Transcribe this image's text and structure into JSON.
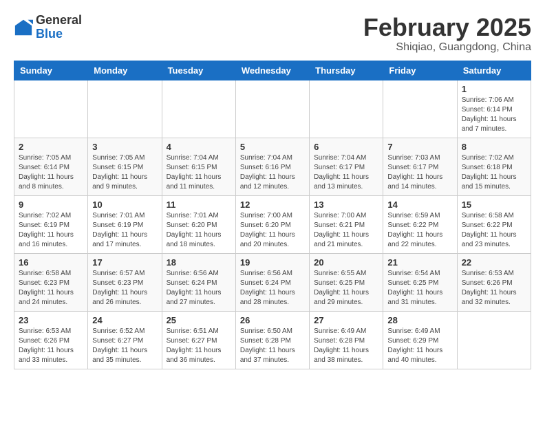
{
  "header": {
    "logo": {
      "general": "General",
      "blue": "Blue"
    },
    "title": "February 2025",
    "location": "Shiqiao, Guangdong, China"
  },
  "weekdays": [
    "Sunday",
    "Monday",
    "Tuesday",
    "Wednesday",
    "Thursday",
    "Friday",
    "Saturday"
  ],
  "weeks": [
    [
      {
        "day": "",
        "info": ""
      },
      {
        "day": "",
        "info": ""
      },
      {
        "day": "",
        "info": ""
      },
      {
        "day": "",
        "info": ""
      },
      {
        "day": "",
        "info": ""
      },
      {
        "day": "",
        "info": ""
      },
      {
        "day": "1",
        "info": "Sunrise: 7:06 AM\nSunset: 6:14 PM\nDaylight: 11 hours\nand 7 minutes."
      }
    ],
    [
      {
        "day": "2",
        "info": "Sunrise: 7:05 AM\nSunset: 6:14 PM\nDaylight: 11 hours\nand 8 minutes."
      },
      {
        "day": "3",
        "info": "Sunrise: 7:05 AM\nSunset: 6:15 PM\nDaylight: 11 hours\nand 9 minutes."
      },
      {
        "day": "4",
        "info": "Sunrise: 7:04 AM\nSunset: 6:15 PM\nDaylight: 11 hours\nand 11 minutes."
      },
      {
        "day": "5",
        "info": "Sunrise: 7:04 AM\nSunset: 6:16 PM\nDaylight: 11 hours\nand 12 minutes."
      },
      {
        "day": "6",
        "info": "Sunrise: 7:04 AM\nSunset: 6:17 PM\nDaylight: 11 hours\nand 13 minutes."
      },
      {
        "day": "7",
        "info": "Sunrise: 7:03 AM\nSunset: 6:17 PM\nDaylight: 11 hours\nand 14 minutes."
      },
      {
        "day": "8",
        "info": "Sunrise: 7:02 AM\nSunset: 6:18 PM\nDaylight: 11 hours\nand 15 minutes."
      }
    ],
    [
      {
        "day": "9",
        "info": "Sunrise: 7:02 AM\nSunset: 6:19 PM\nDaylight: 11 hours\nand 16 minutes."
      },
      {
        "day": "10",
        "info": "Sunrise: 7:01 AM\nSunset: 6:19 PM\nDaylight: 11 hours\nand 17 minutes."
      },
      {
        "day": "11",
        "info": "Sunrise: 7:01 AM\nSunset: 6:20 PM\nDaylight: 11 hours\nand 18 minutes."
      },
      {
        "day": "12",
        "info": "Sunrise: 7:00 AM\nSunset: 6:20 PM\nDaylight: 11 hours\nand 20 minutes."
      },
      {
        "day": "13",
        "info": "Sunrise: 7:00 AM\nSunset: 6:21 PM\nDaylight: 11 hours\nand 21 minutes."
      },
      {
        "day": "14",
        "info": "Sunrise: 6:59 AM\nSunset: 6:22 PM\nDaylight: 11 hours\nand 22 minutes."
      },
      {
        "day": "15",
        "info": "Sunrise: 6:58 AM\nSunset: 6:22 PM\nDaylight: 11 hours\nand 23 minutes."
      }
    ],
    [
      {
        "day": "16",
        "info": "Sunrise: 6:58 AM\nSunset: 6:23 PM\nDaylight: 11 hours\nand 24 minutes."
      },
      {
        "day": "17",
        "info": "Sunrise: 6:57 AM\nSunset: 6:23 PM\nDaylight: 11 hours\nand 26 minutes."
      },
      {
        "day": "18",
        "info": "Sunrise: 6:56 AM\nSunset: 6:24 PM\nDaylight: 11 hours\nand 27 minutes."
      },
      {
        "day": "19",
        "info": "Sunrise: 6:56 AM\nSunset: 6:24 PM\nDaylight: 11 hours\nand 28 minutes."
      },
      {
        "day": "20",
        "info": "Sunrise: 6:55 AM\nSunset: 6:25 PM\nDaylight: 11 hours\nand 29 minutes."
      },
      {
        "day": "21",
        "info": "Sunrise: 6:54 AM\nSunset: 6:25 PM\nDaylight: 11 hours\nand 31 minutes."
      },
      {
        "day": "22",
        "info": "Sunrise: 6:53 AM\nSunset: 6:26 PM\nDaylight: 11 hours\nand 32 minutes."
      }
    ],
    [
      {
        "day": "23",
        "info": "Sunrise: 6:53 AM\nSunset: 6:26 PM\nDaylight: 11 hours\nand 33 minutes."
      },
      {
        "day": "24",
        "info": "Sunrise: 6:52 AM\nSunset: 6:27 PM\nDaylight: 11 hours\nand 35 minutes."
      },
      {
        "day": "25",
        "info": "Sunrise: 6:51 AM\nSunset: 6:27 PM\nDaylight: 11 hours\nand 36 minutes."
      },
      {
        "day": "26",
        "info": "Sunrise: 6:50 AM\nSunset: 6:28 PM\nDaylight: 11 hours\nand 37 minutes."
      },
      {
        "day": "27",
        "info": "Sunrise: 6:49 AM\nSunset: 6:28 PM\nDaylight: 11 hours\nand 38 minutes."
      },
      {
        "day": "28",
        "info": "Sunrise: 6:49 AM\nSunset: 6:29 PM\nDaylight: 11 hours\nand 40 minutes."
      },
      {
        "day": "",
        "info": ""
      }
    ]
  ]
}
